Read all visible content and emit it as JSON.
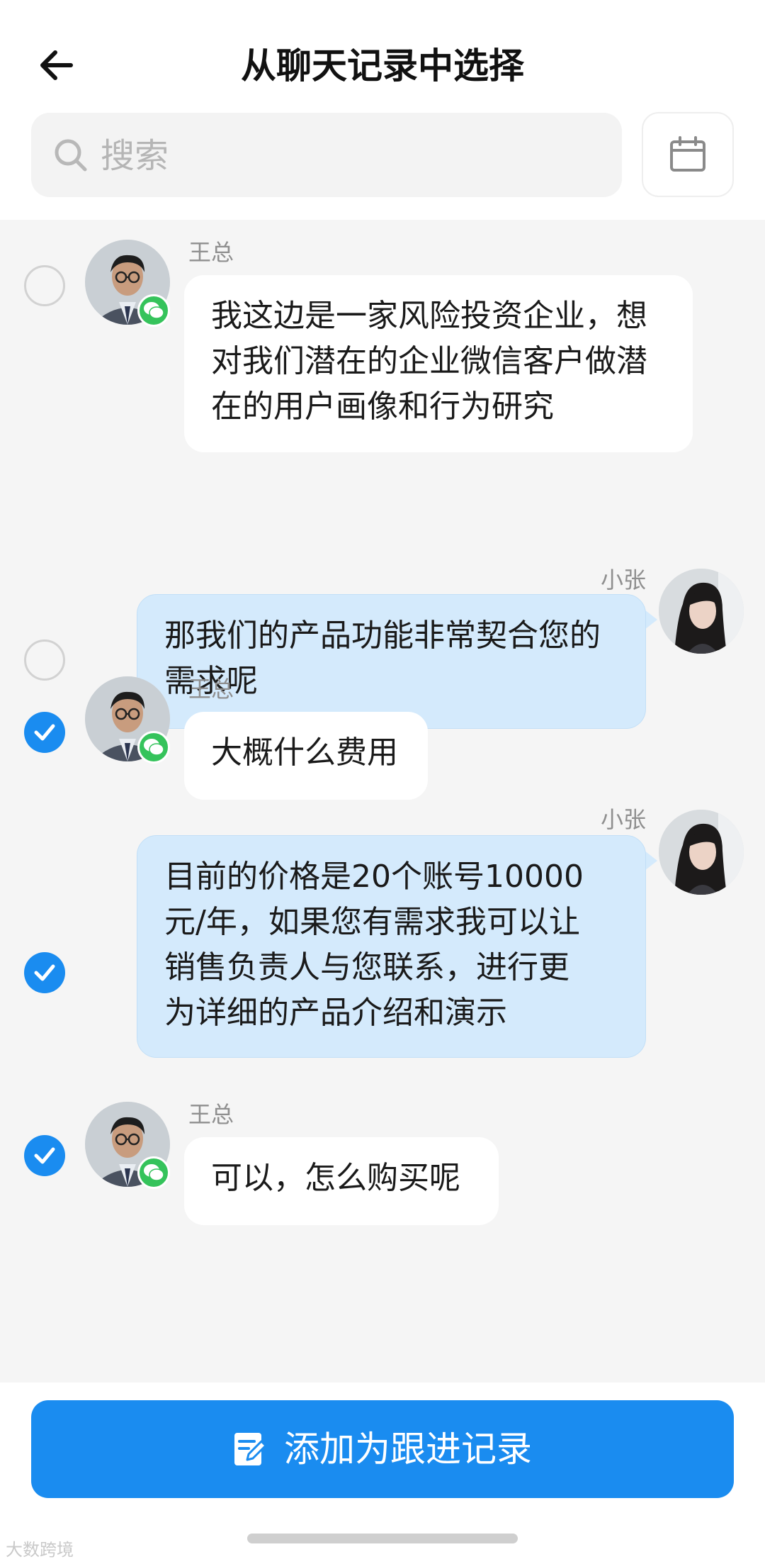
{
  "header": {
    "title": "从聊天记录中选择",
    "back_icon": "arrow-left-icon"
  },
  "search": {
    "placeholder": "搜索",
    "value": "",
    "icon": "search-icon",
    "calendar_icon": "calendar-icon"
  },
  "messages": [
    {
      "sender": "王总",
      "direction": "incoming",
      "selected": false,
      "text": "我这边是一家风险投资企业，想\n对我们潜在的企业微信客户做潜\n在的用户画像和行为研究",
      "avatar": "man-glasses-avatar",
      "badge": "wechat-icon"
    },
    {
      "sender": "小张",
      "direction": "outgoing",
      "selected": false,
      "text": "那我们的产品功能非常契合您的\n需求呢",
      "avatar": "woman-avatar"
    },
    {
      "sender": "王总",
      "direction": "incoming",
      "selected": true,
      "text": "大概什么费用",
      "avatar": "man-glasses-avatar",
      "badge": "wechat-icon"
    },
    {
      "sender": "小张",
      "direction": "outgoing",
      "selected": true,
      "text": "目前的价格是20个账号10000\n元/年，如果您有需求我可以让\n销售负责人与您联系，进行更\n为详细的产品介绍和演示",
      "avatar": "woman-avatar"
    },
    {
      "sender": "王总",
      "direction": "incoming",
      "selected": true,
      "text": "可以，怎么购买呢",
      "avatar": "man-glasses-avatar",
      "badge": "wechat-icon"
    }
  ],
  "footer": {
    "action_label": "添加为跟进记录",
    "action_icon": "edit-note-icon"
  },
  "watermark": "大数跨境",
  "colors": {
    "accent": "#1a8cf0",
    "outgoing_bubble": "#d4eafc",
    "incoming_bubble": "#ffffff",
    "chat_background": "#f5f5f5",
    "wechat_green": "#35c35b"
  }
}
